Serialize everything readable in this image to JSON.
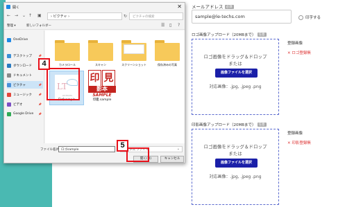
{
  "form": {
    "email_label": "メールアドレス",
    "email_required": "必須",
    "email_value": "sample@le-techs.com",
    "print_label": "印字する",
    "logo_section_label": "ロゴ画像アップロード（20MBまで）",
    "logo_section_badge": "任意",
    "logo_upload": {
      "line1": "ロゴ画像をドラッグ＆ドロップ",
      "line2": "または",
      "button": "画像ファイルを選択",
      "formats": "対応画像：.jpg, .jpeg .png"
    },
    "logo_status_label": "登録画像",
    "logo_status_error": "✕ ロゴ登録無",
    "seal_section_label": "印影画像アップロード（20MBまで）",
    "seal_section_badge": "任意",
    "seal_upload": {
      "line1": "ロゴ画像をドラッグ＆ドロップ",
      "line2": "または",
      "button": "画像ファイルを選択",
      "formats": "対応画像：.jpg, .jpeg .png"
    },
    "seal_status_label": "登録画像",
    "seal_status_error": "✕ 印影登録無"
  },
  "dialog": {
    "title": "開く",
    "close": "✕",
    "address": "› ピクチャ ›",
    "search_placeholder": "ピクチャの検索",
    "toolbar": {
      "organize": "整理 ▾",
      "new_folder": "新しいフォルダー"
    },
    "nav_items": [
      {
        "label": "OneDrive",
        "color": "#1e88e5"
      },
      {
        "label": "デスクトップ",
        "color": "#3c8fd6"
      },
      {
        "label": "ダウンロード",
        "color": "#2a7ac0"
      },
      {
        "label": "ドキュメント",
        "color": "#8a8a8a"
      },
      {
        "label": "ピクチャ",
        "color": "#4a90d9"
      },
      {
        "label": "ミュージック",
        "color": "#e2463b"
      },
      {
        "label": "ビデオ",
        "color": "#7b4fc4"
      },
      {
        "label": "Google Drive",
        "color": "#2faa55"
      }
    ],
    "folders": [
      {
        "label": "カメラロール"
      },
      {
        "label": "スキャン"
      },
      {
        "label": "スクリーンショット"
      },
      {
        "label": "保存済みの写真"
      }
    ],
    "files": [
      {
        "label": "ロゴsample"
      },
      {
        "label": "印鑑 sample"
      }
    ],
    "logo_thumb_caption": "LE-TECHS",
    "seal_chars": [
      "印",
      "見",
      "影",
      "本"
    ],
    "seal_stamp": "SAMPLE",
    "filename_label": "ファイル名(N):",
    "filename_value": "ロゴsample",
    "filter_value": "カスタム ファイル",
    "open_button": "開く(O)",
    "cancel_button": "キャンセル"
  },
  "annotations": {
    "step4": "4",
    "step5": "5",
    "highlight_color": "#e8101a"
  }
}
